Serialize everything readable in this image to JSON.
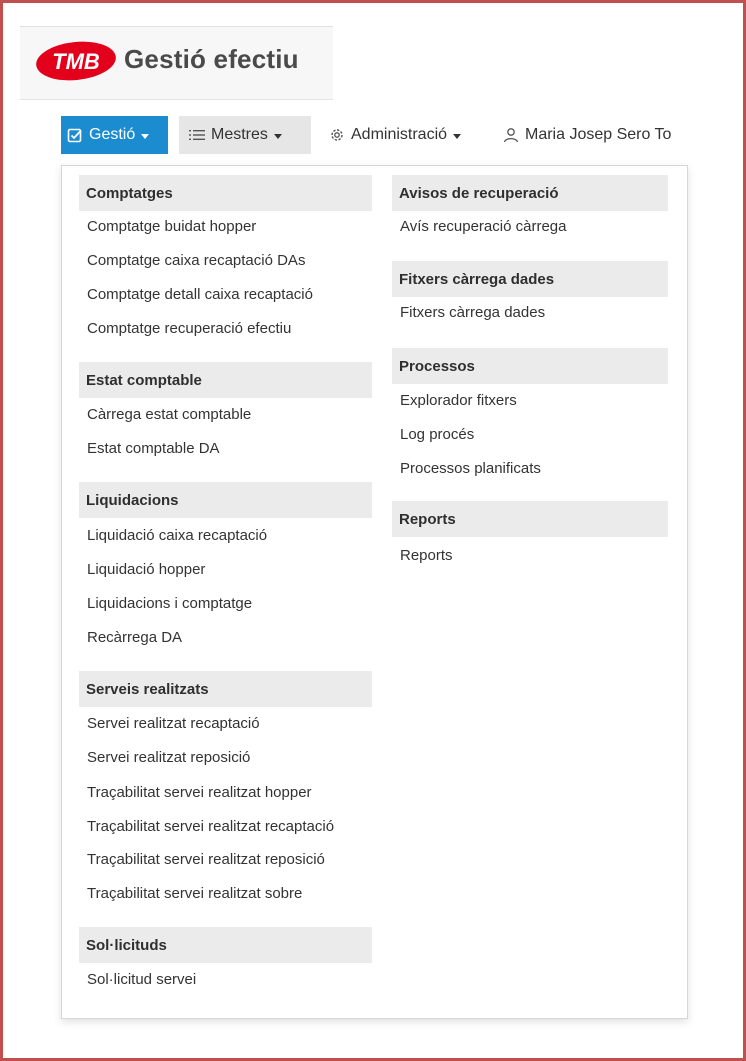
{
  "app": {
    "logo_text": "TMB",
    "title": "Gestió efectiu",
    "brand_color": "#e3001b"
  },
  "navbar": {
    "gestio": {
      "label": "Gestió",
      "icon": "edit-check-icon",
      "color": "#1b8cd0"
    },
    "mestres": {
      "label": "Mestres",
      "icon": "list-icon"
    },
    "administracio": {
      "label": "Administració",
      "icon": "gear-icon"
    },
    "user": {
      "label": "Maria Josep Sero To",
      "icon": "user-icon"
    }
  },
  "menu": {
    "left": [
      {
        "title": "Comptatges",
        "items": [
          "Comptatge buidat hopper",
          "Comptatge caixa recaptació DAs",
          "Comptatge detall caixa recaptació",
          "Comptatge recuperació efectiu"
        ]
      },
      {
        "title": "Estat comptable",
        "items": [
          "Càrrega estat comptable",
          "Estat comptable DA"
        ]
      },
      {
        "title": "Liquidacions",
        "items": [
          "Liquidació caixa recaptació",
          "Liquidació hopper",
          "Liquidacions i comptatge",
          "Recàrrega DA"
        ]
      },
      {
        "title": "Serveis realitzats",
        "items": [
          "Servei realitzat recaptació",
          "Servei realitzat reposició",
          "Traçabilitat servei realitzat hopper",
          "Traçabilitat servei realitzat recaptació",
          "Traçabilitat servei realitzat reposició",
          "Traçabilitat servei realitzat sobre"
        ]
      },
      {
        "title": "Sol·licituds",
        "items": [
          "Sol·licitud servei"
        ]
      }
    ],
    "right": [
      {
        "title": "Avisos de recuperació",
        "items": [
          "Avís recuperació càrrega"
        ]
      },
      {
        "title": "Fitxers càrrega dades",
        "items": [
          "Fitxers càrrega dades"
        ]
      },
      {
        "title": "Processos",
        "items": [
          "Explorador fitxers",
          "Log procés",
          "Processos planificats"
        ]
      },
      {
        "title": "Reports",
        "items": [
          "Reports"
        ]
      }
    ]
  }
}
